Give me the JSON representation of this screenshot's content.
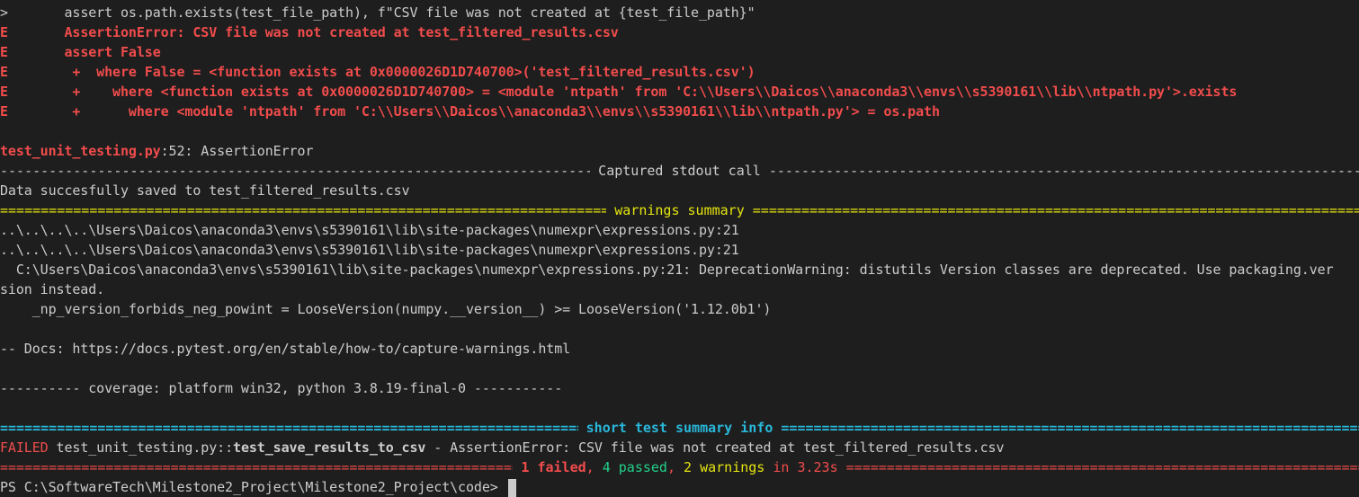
{
  "lines": {
    "l1_marker": ">",
    "l1_text": "       assert os.path.exists(test_file_path), f\"CSV file was not created at {test_file_path}\"",
    "l2_marker": "E",
    "l2_text": "       AssertionError: CSV file was not created at test_filtered_results.csv",
    "l3_marker": "E",
    "l3_text": "       assert False",
    "l4_marker": "E",
    "l4_text": "        +  where False = <function exists at 0x0000026D1D740700>('test_filtered_results.csv')",
    "l5_marker": "E",
    "l5_text": "        +    where <function exists at 0x0000026D1D740700> = <module 'ntpath' from 'C:\\\\Users\\\\Daicos\\\\anaconda3\\\\envs\\\\s5390161\\\\lib\\\\ntpath.py'>.exists",
    "l6_marker": "E",
    "l6_text": "        +      where <module 'ntpath' from 'C:\\\\Users\\\\Daicos\\\\anaconda3\\\\envs\\\\s5390161\\\\lib\\\\ntpath.py'> = os.path",
    "loc_file": "test_unit_testing.py",
    "loc_rest": ":52: AssertionError",
    "stdout_title": " Captured stdout call ",
    "stdout_text": "Data succesfully saved to test_filtered_results.csv",
    "warnings_title": " warnings summary ",
    "warn1": "..\\..\\..\\..\\Users\\Daicos\\anaconda3\\envs\\s5390161\\lib\\site-packages\\numexpr\\expressions.py:21",
    "warn2": "..\\..\\..\\..\\Users\\Daicos\\anaconda3\\envs\\s5390161\\lib\\site-packages\\numexpr\\expressions.py:21",
    "warn3": "  C:\\Users\\Daicos\\anaconda3\\envs\\s5390161\\lib\\site-packages\\numexpr\\expressions.py:21: DeprecationWarning: distutils Version classes are deprecated. Use packaging.ver",
    "warn4": "sion instead.",
    "warn5": "    _np_version_forbids_neg_powint = LooseVersion(numpy.__version__) >= LooseVersion('1.12.0b1')",
    "docs": "-- Docs: https://docs.pytest.org/en/stable/how-to/capture-warnings.html",
    "coverage": "---------- coverage: platform win32, python 3.8.19-final-0 -----------",
    "summary_title": " short test summary info ",
    "failed_label": "FAILED",
    "failed_file": " test_unit_testing.py::",
    "failed_test": "test_save_results_to_csv",
    "failed_msg": " - AssertionError: CSV file was not created at test_filtered_results.csv",
    "result_failed": "1 failed",
    "result_sep1": ", ",
    "result_passed": "4 passed",
    "result_sep2": ", ",
    "result_warnings": "2 warnings",
    "result_time": " in 3.23s",
    "prompt": "PS C:\\SoftwareTech\\Milestone2_Project\\Milestone2_Project\\code> "
  },
  "colors": {
    "background": "#1e1e1e",
    "text": "#cccccc",
    "error_red": "#f14c4c",
    "warning_yellow": "#e5e510",
    "info_cyan": "#29b8db",
    "pass_green": "#23d18b"
  }
}
